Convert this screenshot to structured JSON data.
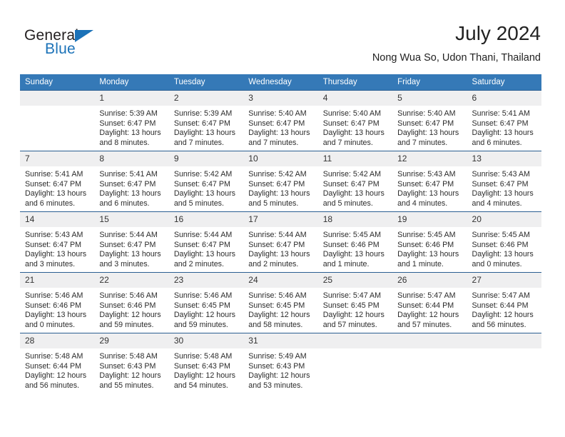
{
  "brand": {
    "name_top": "General",
    "name_bottom": "Blue",
    "triangle_icon": "triangle-logo-icon",
    "color_top": "#231f20",
    "color_bottom": "#1b72b8"
  },
  "header": {
    "title": "July 2024",
    "subtitle": "Nong Wua So, Udon Thani, Thailand"
  },
  "colors": {
    "header_blue": "#3579b7",
    "row_separator": "#2b5f92",
    "daynum_band": "#efeff0",
    "text": "#2b2b2b"
  },
  "weekdays": [
    "Sunday",
    "Monday",
    "Tuesday",
    "Wednesday",
    "Thursday",
    "Friday",
    "Saturday"
  ],
  "weeks": [
    [
      {
        "day": "",
        "empty": true,
        "sunrise": "",
        "sunset": "",
        "daylight": ""
      },
      {
        "day": "1",
        "sunrise": "Sunrise: 5:39 AM",
        "sunset": "Sunset: 6:47 PM",
        "daylight": "Daylight: 13 hours and 8 minutes."
      },
      {
        "day": "2",
        "sunrise": "Sunrise: 5:39 AM",
        "sunset": "Sunset: 6:47 PM",
        "daylight": "Daylight: 13 hours and 7 minutes."
      },
      {
        "day": "3",
        "sunrise": "Sunrise: 5:40 AM",
        "sunset": "Sunset: 6:47 PM",
        "daylight": "Daylight: 13 hours and 7 minutes."
      },
      {
        "day": "4",
        "sunrise": "Sunrise: 5:40 AM",
        "sunset": "Sunset: 6:47 PM",
        "daylight": "Daylight: 13 hours and 7 minutes."
      },
      {
        "day": "5",
        "sunrise": "Sunrise: 5:40 AM",
        "sunset": "Sunset: 6:47 PM",
        "daylight": "Daylight: 13 hours and 7 minutes."
      },
      {
        "day": "6",
        "sunrise": "Sunrise: 5:41 AM",
        "sunset": "Sunset: 6:47 PM",
        "daylight": "Daylight: 13 hours and 6 minutes."
      }
    ],
    [
      {
        "day": "7",
        "sunrise": "Sunrise: 5:41 AM",
        "sunset": "Sunset: 6:47 PM",
        "daylight": "Daylight: 13 hours and 6 minutes."
      },
      {
        "day": "8",
        "sunrise": "Sunrise: 5:41 AM",
        "sunset": "Sunset: 6:47 PM",
        "daylight": "Daylight: 13 hours and 6 minutes."
      },
      {
        "day": "9",
        "sunrise": "Sunrise: 5:42 AM",
        "sunset": "Sunset: 6:47 PM",
        "daylight": "Daylight: 13 hours and 5 minutes."
      },
      {
        "day": "10",
        "sunrise": "Sunrise: 5:42 AM",
        "sunset": "Sunset: 6:47 PM",
        "daylight": "Daylight: 13 hours and 5 minutes."
      },
      {
        "day": "11",
        "sunrise": "Sunrise: 5:42 AM",
        "sunset": "Sunset: 6:47 PM",
        "daylight": "Daylight: 13 hours and 5 minutes."
      },
      {
        "day": "12",
        "sunrise": "Sunrise: 5:43 AM",
        "sunset": "Sunset: 6:47 PM",
        "daylight": "Daylight: 13 hours and 4 minutes."
      },
      {
        "day": "13",
        "sunrise": "Sunrise: 5:43 AM",
        "sunset": "Sunset: 6:47 PM",
        "daylight": "Daylight: 13 hours and 4 minutes."
      }
    ],
    [
      {
        "day": "14",
        "sunrise": "Sunrise: 5:43 AM",
        "sunset": "Sunset: 6:47 PM",
        "daylight": "Daylight: 13 hours and 3 minutes."
      },
      {
        "day": "15",
        "sunrise": "Sunrise: 5:44 AM",
        "sunset": "Sunset: 6:47 PM",
        "daylight": "Daylight: 13 hours and 3 minutes."
      },
      {
        "day": "16",
        "sunrise": "Sunrise: 5:44 AM",
        "sunset": "Sunset: 6:47 PM",
        "daylight": "Daylight: 13 hours and 2 minutes."
      },
      {
        "day": "17",
        "sunrise": "Sunrise: 5:44 AM",
        "sunset": "Sunset: 6:47 PM",
        "daylight": "Daylight: 13 hours and 2 minutes."
      },
      {
        "day": "18",
        "sunrise": "Sunrise: 5:45 AM",
        "sunset": "Sunset: 6:46 PM",
        "daylight": "Daylight: 13 hours and 1 minute."
      },
      {
        "day": "19",
        "sunrise": "Sunrise: 5:45 AM",
        "sunset": "Sunset: 6:46 PM",
        "daylight": "Daylight: 13 hours and 1 minute."
      },
      {
        "day": "20",
        "sunrise": "Sunrise: 5:45 AM",
        "sunset": "Sunset: 6:46 PM",
        "daylight": "Daylight: 13 hours and 0 minutes."
      }
    ],
    [
      {
        "day": "21",
        "sunrise": "Sunrise: 5:46 AM",
        "sunset": "Sunset: 6:46 PM",
        "daylight": "Daylight: 13 hours and 0 minutes."
      },
      {
        "day": "22",
        "sunrise": "Sunrise: 5:46 AM",
        "sunset": "Sunset: 6:46 PM",
        "daylight": "Daylight: 12 hours and 59 minutes."
      },
      {
        "day": "23",
        "sunrise": "Sunrise: 5:46 AM",
        "sunset": "Sunset: 6:45 PM",
        "daylight": "Daylight: 12 hours and 59 minutes."
      },
      {
        "day": "24",
        "sunrise": "Sunrise: 5:46 AM",
        "sunset": "Sunset: 6:45 PM",
        "daylight": "Daylight: 12 hours and 58 minutes."
      },
      {
        "day": "25",
        "sunrise": "Sunrise: 5:47 AM",
        "sunset": "Sunset: 6:45 PM",
        "daylight": "Daylight: 12 hours and 57 minutes."
      },
      {
        "day": "26",
        "sunrise": "Sunrise: 5:47 AM",
        "sunset": "Sunset: 6:44 PM",
        "daylight": "Daylight: 12 hours and 57 minutes."
      },
      {
        "day": "27",
        "sunrise": "Sunrise: 5:47 AM",
        "sunset": "Sunset: 6:44 PM",
        "daylight": "Daylight: 12 hours and 56 minutes."
      }
    ],
    [
      {
        "day": "28",
        "sunrise": "Sunrise: 5:48 AM",
        "sunset": "Sunset: 6:44 PM",
        "daylight": "Daylight: 12 hours and 56 minutes."
      },
      {
        "day": "29",
        "sunrise": "Sunrise: 5:48 AM",
        "sunset": "Sunset: 6:43 PM",
        "daylight": "Daylight: 12 hours and 55 minutes."
      },
      {
        "day": "30",
        "sunrise": "Sunrise: 5:48 AM",
        "sunset": "Sunset: 6:43 PM",
        "daylight": "Daylight: 12 hours and 54 minutes."
      },
      {
        "day": "31",
        "sunrise": "Sunrise: 5:49 AM",
        "sunset": "Sunset: 6:43 PM",
        "daylight": "Daylight: 12 hours and 53 minutes."
      },
      {
        "day": "",
        "empty": true,
        "sunrise": "",
        "sunset": "",
        "daylight": ""
      },
      {
        "day": "",
        "empty": true,
        "sunrise": "",
        "sunset": "",
        "daylight": ""
      },
      {
        "day": "",
        "empty": true,
        "sunrise": "",
        "sunset": "",
        "daylight": ""
      }
    ]
  ]
}
